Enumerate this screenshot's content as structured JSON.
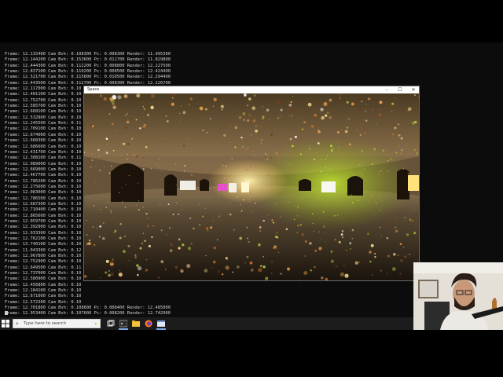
{
  "console": {
    "lines": [
      "Frame: 12.115400 Cam Bvh: 0.108300 Pc: 0.008300 Render: 11.995300",
      "Frame: 12.144200 Cam Bvh: 0.153600 Pc: 0.011700 Render: 11.829800",
      "Frame: 12.444300 Cam Bvh: 0.112200 Pc: 0.008800 Render: 12.227500",
      "Frame: 12.837100 Cam Bvh: 0.110200 Pc: 0.008500 Render: 12.424400",
      "Frame: 12.521700 Cam Bvh: 0.115600 Pc: 0.010500 Render: 12.294400",
      "Frame: 12.443500 Cam Bvh: 0.112700 Pc: 0.008300 Render: 12.226700",
      "Frame: 12.117000 Cam Bvh: 0.10",
      "Frame: 12.401100 Cam Bvh: 0.10",
      "Frame: 12.752700 Cam Bvh: 0.10",
      "Frame: 12.585700 Cam Bvh: 0.10",
      "Frame: 12.668100 Cam Bvh: 0.10",
      "Frame: 12.532800 Cam Bvh: 0.10",
      "Frame: 12.245500 Cam Bvh: 0.11",
      "Frame: 12.709100 Cam Bvh: 0.10",
      "Frame: 12.674000 Cam Bvh: 0.10",
      "Frame: 12.668300 Cam Bvh: 0.10",
      "Frame: 12.686600 Cam Bvh: 0.10",
      "Frame: 12.431700 Cam Bvh: 0.10",
      "Frame: 12.308100 Cam Bvh: 0.11",
      "Frame: 12.089000 Cam Bvh: 0.10",
      "Frame: 12.669000 Cam Bvh: 0.10",
      "Frame: 12.467700 Cam Bvh: 0.10",
      "Frame: 12.786200 Cam Bvh: 0.10",
      "Frame: 12.275600 Cam Bvh: 0.10",
      "Frame: 12.083000 Cam Bvh: 0.10",
      "Frame: 12.786500 Cam Bvh: 0.10",
      "Frame: 12.687300 Cam Bvh: 0.10",
      "Frame: 12.710400 Cam Bvh: 0.10",
      "Frame: 12.865600 Cam Bvh: 0.10",
      "Frame: 12.059700 Cam Bvh: 0.10",
      "Frame: 12.392900 Cam Bvh: 0.10",
      "Frame: 12.033300 Cam Bvh: 0.10",
      "Frame: 12.762100 Cam Bvh: 0.10",
      "Frame: 13.740100 Cam Bvh: 0.10",
      "Frame: 11.043300 Cam Bvh: 0.12",
      "Frame: 12.967800 Cam Bvh: 0.10",
      "Frame: 12.752900 Cam Bvh: 0.10",
      "Frame: 12.649500 Cam Bvh: 0.11",
      "Frame: 12.737000 Cam Bvh: 0.10",
      "Frame: 12.580900 Cam Bvh: 0.10",
      "Frame: 12.456800 Cam Bvh: 0.10",
      "Frame: 12.184100 Cam Bvh: 0.10",
      "Frame: 12.671000 Cam Bvh: 0.10",
      "Frame: 12.572300 Cam Bvh: 0.10",
      "Frame: 12.701800 Cam Bvh: 0.108600 Pc: 0.008400 Render: 12.485000",
      "Frame: 12.953400 Cam Bvh: 0.107600 Pc: 0.008200 Render: 12.742900",
      "Frame: 12.493100 Cam Bvh: 0.106200 Pc: 0.008400 Render: 12.286800",
      "Frame: 12.256700 Cam Bvh: 0.108500 Pc: 0.008200 Render: 12.079000",
      "Frame: 12.600400 Cam Bvh: 0.130200 Pc: 0.008500 Render: 12.373000"
    ]
  },
  "render_window": {
    "title": "Space",
    "minimize_glyph": "–",
    "maximize_glyph": "☐",
    "close_glyph": "✕"
  },
  "taskbar": {
    "search_placeholder": "Type here to search",
    "search_icon": "magnifier-icon",
    "start_icon": "windows-logo-icon",
    "pinned_icons": [
      "task-view-icon",
      "console-app-icon",
      "file-explorer-icon",
      "firefox-icon",
      "terminal-app-icon",
      "active-window-icon"
    ]
  },
  "colors": {
    "console_bg": "#0c0c0c",
    "console_text": "#cfcfcf",
    "taskbar_bg": "#1c1c1c",
    "green_light": "#a6d11c",
    "warm_light": "#ffd779"
  }
}
